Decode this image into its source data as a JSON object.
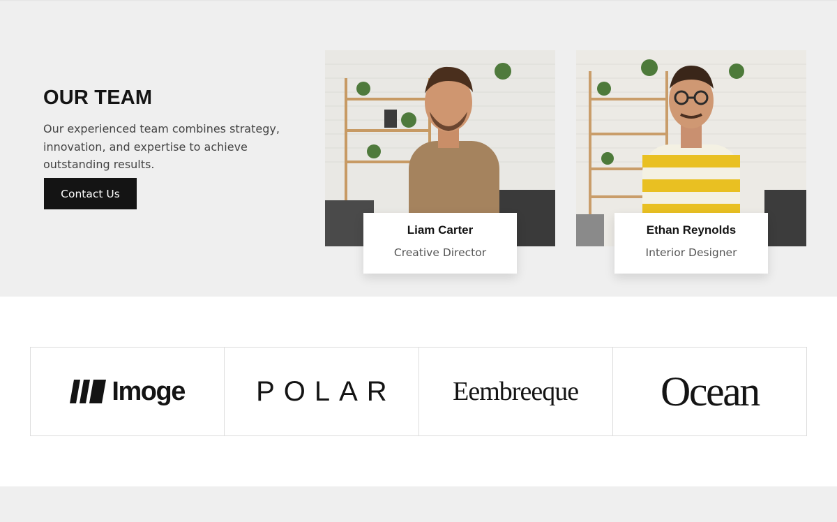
{
  "team": {
    "heading": "OUR TEAM",
    "description": "Our experienced team combines strategy, innovation, and expertise to achieve outstanding results.",
    "cta_label": "Contact Us",
    "members": [
      {
        "name": "Liam Carter",
        "role": "Creative Director"
      },
      {
        "name": "Ethan Reynolds",
        "role": "Interior Designer"
      }
    ]
  },
  "logos": [
    {
      "name": "Imoge"
    },
    {
      "name": "POLAR"
    },
    {
      "name": "Eembreeque"
    },
    {
      "name": "Ocean"
    }
  ],
  "colors": {
    "section_bg": "#efefef",
    "button_bg": "#141414",
    "text_dark": "#141414",
    "text_muted": "#555555"
  }
}
